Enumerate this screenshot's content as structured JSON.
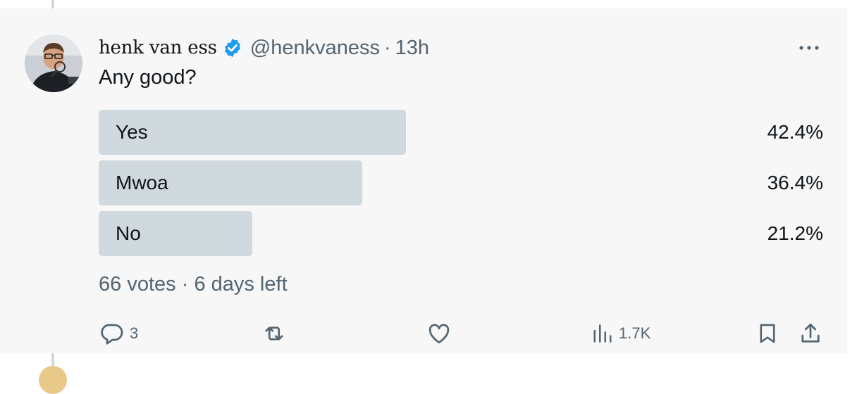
{
  "tweet": {
    "display_name": "henk van ess",
    "handle": "@henkvaness",
    "separator": "·",
    "time": "13h",
    "text": "Any good?",
    "verified": true,
    "accent_color": "#1d9bf0"
  },
  "poll": {
    "options": [
      {
        "label": "Yes",
        "percent": "42.4%",
        "fraction": 0.424
      },
      {
        "label": "Mwoa",
        "percent": "36.4%",
        "fraction": 0.364
      },
      {
        "label": "No",
        "percent": "21.2%",
        "fraction": 0.212
      }
    ],
    "votes": "66 votes",
    "separator": "·",
    "time_left": "6 days left"
  },
  "actions": {
    "reply_count": "3",
    "views_count": "1.7K"
  },
  "icons": {
    "more": "more-icon",
    "verified": "verified-badge-icon",
    "reply": "reply-icon",
    "retweet": "retweet-icon",
    "like": "heart-icon",
    "views": "views-icon",
    "bookmark": "bookmark-icon",
    "share": "share-icon"
  },
  "colors": {
    "poll_bar": "#cfd9de",
    "secondary_text": "#536471",
    "card_background": "#f7f7f7"
  }
}
